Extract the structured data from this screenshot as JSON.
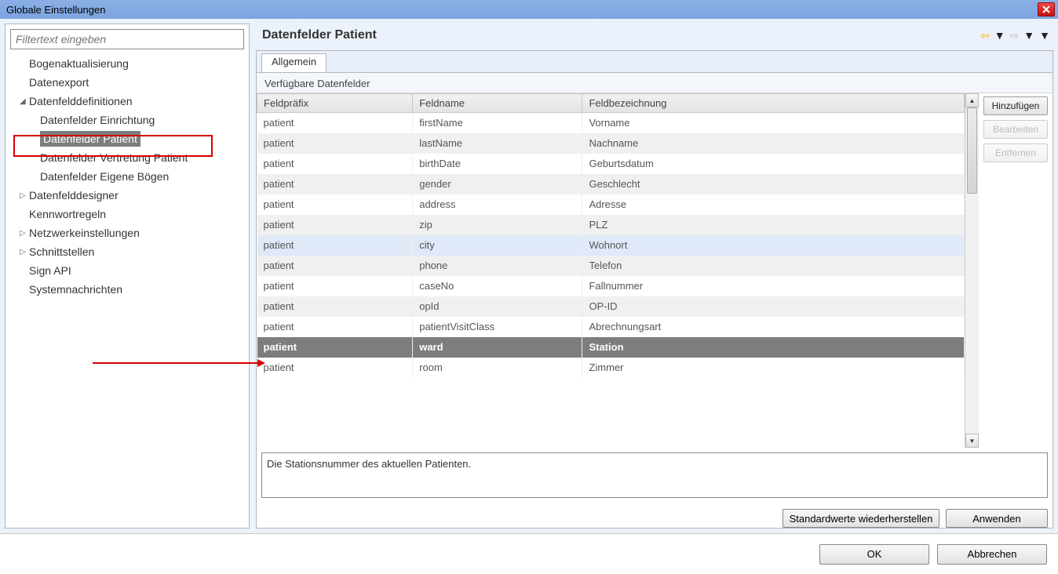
{
  "window": {
    "title": "Globale Einstellungen"
  },
  "filter": {
    "placeholder": "Filtertext eingeben"
  },
  "tree": {
    "items": [
      {
        "label": "Bogenaktualisierung",
        "hasArrow": false,
        "expanded": false,
        "children": []
      },
      {
        "label": "Datenexport",
        "hasArrow": false,
        "expanded": false,
        "children": []
      },
      {
        "label": "Datenfelddefinitionen",
        "hasArrow": true,
        "expanded": true,
        "children": [
          {
            "label": "Datenfelder Einrichtung"
          },
          {
            "label": "Datenfelder Patient",
            "selected": true
          },
          {
            "label": "Datenfelder Vertretung Patient"
          },
          {
            "label": "Datenfelder Eigene Bögen"
          }
        ]
      },
      {
        "label": "Datenfelddesigner",
        "hasArrow": true,
        "expanded": false,
        "children": []
      },
      {
        "label": "Kennwortregeln",
        "hasArrow": false,
        "expanded": false,
        "children": []
      },
      {
        "label": "Netzwerkeinstellungen",
        "hasArrow": true,
        "expanded": false,
        "children": []
      },
      {
        "label": "Schnittstellen",
        "hasArrow": true,
        "expanded": false,
        "children": []
      },
      {
        "label": "Sign API",
        "hasArrow": false,
        "expanded": false,
        "children": []
      },
      {
        "label": "Systemnachrichten",
        "hasArrow": false,
        "expanded": false,
        "children": []
      }
    ]
  },
  "page": {
    "title": "Datenfelder Patient"
  },
  "tab": {
    "label": "Allgemein"
  },
  "group": {
    "label": "Verfügbare Datenfelder"
  },
  "columns": {
    "prefix": "Feldpräfix",
    "name": "Feldname",
    "desc": "Feldbezeichnung"
  },
  "rows": [
    {
      "prefix": "patient",
      "name": "firstName",
      "desc": "Vorname"
    },
    {
      "prefix": "patient",
      "name": "lastName",
      "desc": "Nachname"
    },
    {
      "prefix": "patient",
      "name": "birthDate",
      "desc": "Geburtsdatum"
    },
    {
      "prefix": "patient",
      "name": "gender",
      "desc": "Geschlecht"
    },
    {
      "prefix": "patient",
      "name": "address",
      "desc": "Adresse"
    },
    {
      "prefix": "patient",
      "name": "zip",
      "desc": "PLZ"
    },
    {
      "prefix": "patient",
      "name": "city",
      "desc": "Wohnort",
      "hover": true
    },
    {
      "prefix": "patient",
      "name": "phone",
      "desc": "Telefon"
    },
    {
      "prefix": "patient",
      "name": "caseNo",
      "desc": "Fallnummer"
    },
    {
      "prefix": "patient",
      "name": "opId",
      "desc": "OP-ID"
    },
    {
      "prefix": "patient",
      "name": "patientVisitClass",
      "desc": "Abrechnungsart"
    },
    {
      "prefix": "patient",
      "name": "ward",
      "desc": "Station",
      "selected": true
    },
    {
      "prefix": "patient",
      "name": "room",
      "desc": "Zimmer"
    }
  ],
  "buttons": {
    "add": "Hinzufügen",
    "edit": "Bearbeiten",
    "remove": "Entfernen",
    "restore": "Standardwerte wiederherstellen",
    "apply": "Anwenden",
    "ok": "OK",
    "cancel": "Abbrechen"
  },
  "description": "Die Stationsnummer des aktuellen Patienten."
}
